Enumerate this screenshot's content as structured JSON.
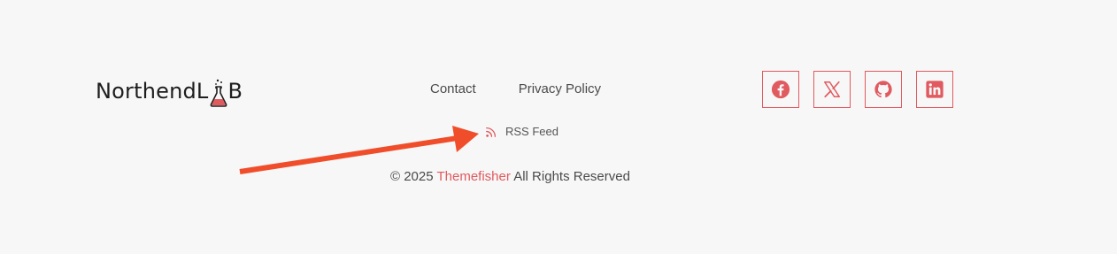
{
  "logo": {
    "text_before": "NorthendL",
    "text_after": "B",
    "accent_color": "#e05a5f"
  },
  "nav": {
    "items": [
      {
        "label": "Contact"
      },
      {
        "label": "Privacy Policy"
      }
    ]
  },
  "social": {
    "icons": [
      "facebook-icon",
      "x-icon",
      "github-icon",
      "linkedin-icon"
    ],
    "color": "#e05a5f"
  },
  "rss": {
    "label": "RSS Feed",
    "icon": "rss-icon"
  },
  "copyright": {
    "prefix": "© 2025",
    "brand": "Themefisher",
    "suffix": "All Rights Reserved"
  },
  "annotation": {
    "arrow_color": "#f04e2b"
  },
  "colors": {
    "background": "#f7f7f7",
    "accent": "#e05a5f",
    "text": "#4a4a4a"
  }
}
